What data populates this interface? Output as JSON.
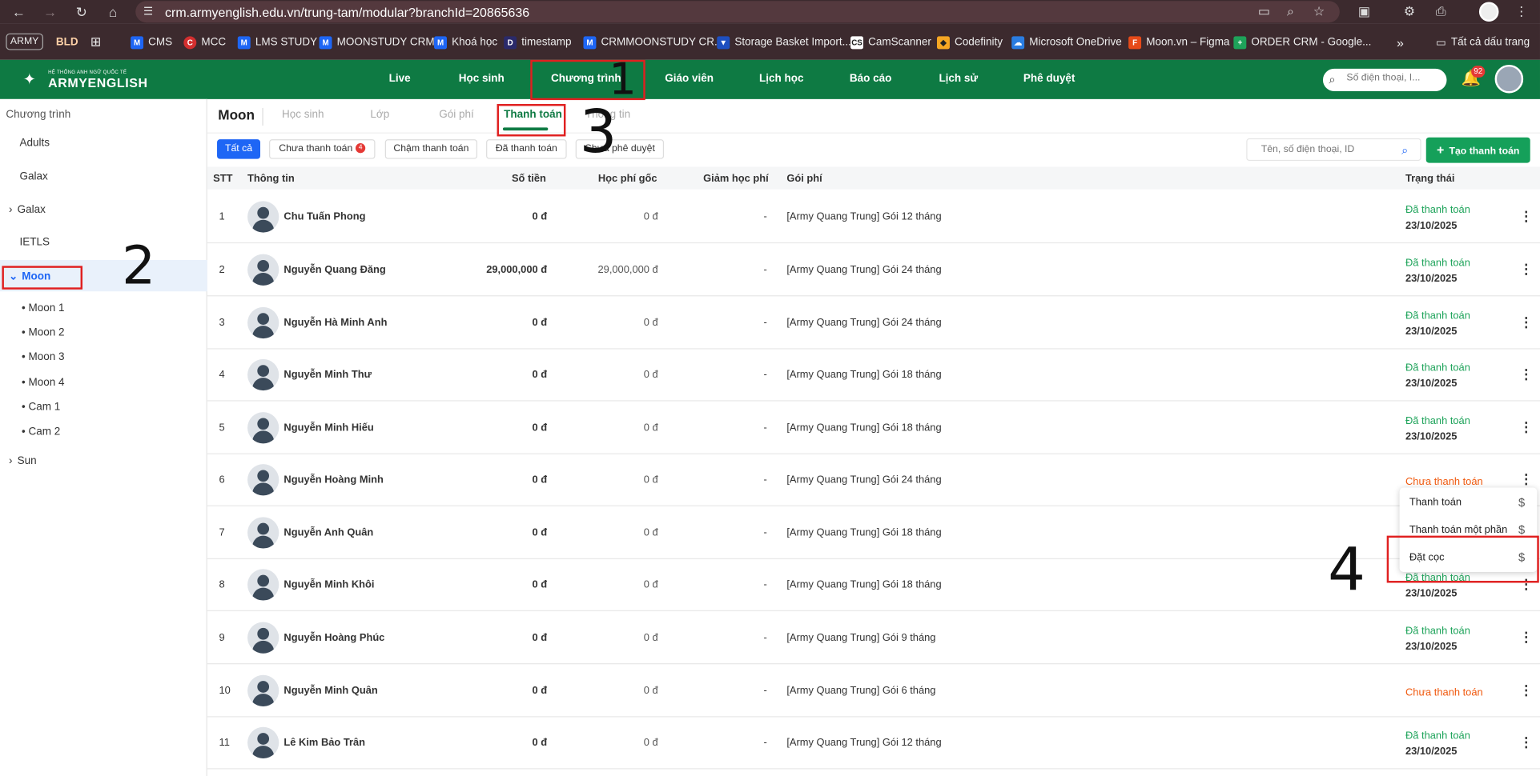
{
  "browser": {
    "url": "crm.armyenglish.edu.vn/trung-tam/modular?branchId=20865636",
    "bookmarks": [
      "CMS",
      "MCC",
      "LMS STUDY",
      "MOONSTUDY CRM",
      "Khoá học",
      "timestamp",
      "CRMMOONSTUDY CR...",
      "Storage Basket Import...",
      "CamScanner",
      "Codefinity",
      "Microsoft OneDrive",
      "Moon.vn – Figma",
      "ORDER CRM - Google..."
    ],
    "chips": [
      "ARMY",
      "BLD"
    ],
    "all_bookmarks": "Tất cả dấu trang"
  },
  "appnav": {
    "logo_sub": "HỆ THỐNG ANH NGỮ QUỐC TẾ",
    "logo_name": "ARMYENGLISH",
    "items": [
      "Live",
      "Học sinh",
      "Chương trình",
      "Giáo viên",
      "Lịch học",
      "Báo cáo",
      "Lịch sử",
      "Phê duyệt"
    ],
    "search_placeholder": "Số điện thoại, I...",
    "notif_count": "92"
  },
  "sidebar": {
    "title": "Chương trình",
    "items": [
      "Adults",
      "Galax",
      "Galax",
      "IETLS",
      "Moon",
      "Sun"
    ],
    "moon_children": [
      "Moon 1",
      "Moon 2",
      "Moon 3",
      "Moon 4",
      "Cam 1",
      "Cam 2"
    ]
  },
  "main": {
    "title": "Moon",
    "tabs": [
      "Học sinh",
      "Lớp",
      "Gói phí",
      "Thanh toán",
      "Thông tin"
    ],
    "filters": [
      "Tất cả",
      "Chưa thanh toán",
      "Chậm thanh toán",
      "Đã thanh toán",
      "Chưa phê duyệt"
    ],
    "unpaid_count": "4",
    "search_placeholder": "Tên, số điện thoại, ID",
    "create_label": "Tạo thanh toán",
    "columns": [
      "STT",
      "Thông tin",
      "Số tiền",
      "Học phí gốc",
      "Giảm học phí",
      "Gói phí",
      "Trạng thái"
    ]
  },
  "rows": [
    {
      "stt": "1",
      "name": "Chu Tuấn Phong",
      "amount": "0 đ",
      "orig": "0 đ",
      "disc": "-",
      "pkg": "[Army Quang Trung] Gói 12 tháng",
      "status": "Đã thanh toán",
      "date": "23/10/2025"
    },
    {
      "stt": "2",
      "name": "Nguyễn Quang Đăng",
      "amount": "29,000,000 đ",
      "orig": "29,000,000 đ",
      "disc": "-",
      "pkg": "[Army Quang Trung] Gói 24 tháng",
      "status": "Đã thanh toán",
      "date": "23/10/2025"
    },
    {
      "stt": "3",
      "name": "Nguyễn Hà Minh Anh",
      "amount": "0 đ",
      "orig": "0 đ",
      "disc": "-",
      "pkg": "[Army Quang Trung] Gói 24 tháng",
      "status": "Đã thanh toán",
      "date": "23/10/2025"
    },
    {
      "stt": "4",
      "name": "Nguyễn Minh Thư",
      "amount": "0 đ",
      "orig": "0 đ",
      "disc": "-",
      "pkg": "[Army Quang Trung] Gói 18 tháng",
      "status": "Đã thanh toán",
      "date": "23/10/2025"
    },
    {
      "stt": "5",
      "name": "Nguyễn Minh Hiếu",
      "amount": "0 đ",
      "orig": "0 đ",
      "disc": "-",
      "pkg": "[Army Quang Trung] Gói 18 tháng",
      "status": "Đã thanh toán",
      "date": "23/10/2025"
    },
    {
      "stt": "6",
      "name": "Nguyễn Hoàng Minh",
      "amount": "0 đ",
      "orig": "0 đ",
      "disc": "-",
      "pkg": "[Army Quang Trung] Gói 24 tháng",
      "status": "Chưa thanh toán",
      "date": ""
    },
    {
      "stt": "7",
      "name": "Nguyễn Anh Quân",
      "amount": "0 đ",
      "orig": "0 đ",
      "disc": "-",
      "pkg": "[Army Quang Trung] Gói 18 tháng",
      "status": "",
      "date": ""
    },
    {
      "stt": "8",
      "name": "Nguyễn Minh Khôi",
      "amount": "0 đ",
      "orig": "0 đ",
      "disc": "-",
      "pkg": "[Army Quang Trung] Gói 18 tháng",
      "status": "Đã thanh toán",
      "date": "23/10/2025"
    },
    {
      "stt": "9",
      "name": "Nguyễn Hoàng Phúc",
      "amount": "0 đ",
      "orig": "0 đ",
      "disc": "-",
      "pkg": "[Army Quang Trung] Gói 9 tháng",
      "status": "Đã thanh toán",
      "date": "23/10/2025"
    },
    {
      "stt": "10",
      "name": "Nguyễn Minh Quân",
      "amount": "0 đ",
      "orig": "0 đ",
      "disc": "-",
      "pkg": "[Army Quang Trung] Gói 6 tháng",
      "status": "Chưa thanh toán",
      "date": ""
    },
    {
      "stt": "11",
      "name": "Lê Kim Bảo Trân",
      "amount": "0 đ",
      "orig": "0 đ",
      "disc": "-",
      "pkg": "[Army Quang Trung] Gói 12 tháng",
      "status": "Đã thanh toán",
      "date": "23/10/2025"
    }
  ],
  "row_menu": {
    "items": [
      "Thanh toán",
      "Thanh toán một phần",
      "Đặt cọc"
    ],
    "icon": "$"
  },
  "annotations": [
    "1",
    "2",
    "3",
    "4"
  ],
  "colors": {
    "brand": "#0e7a43",
    "paid": "#1ea35a",
    "unpaid": "#f0590e",
    "highlight": "#e02020",
    "primary": "#1e66f5"
  }
}
